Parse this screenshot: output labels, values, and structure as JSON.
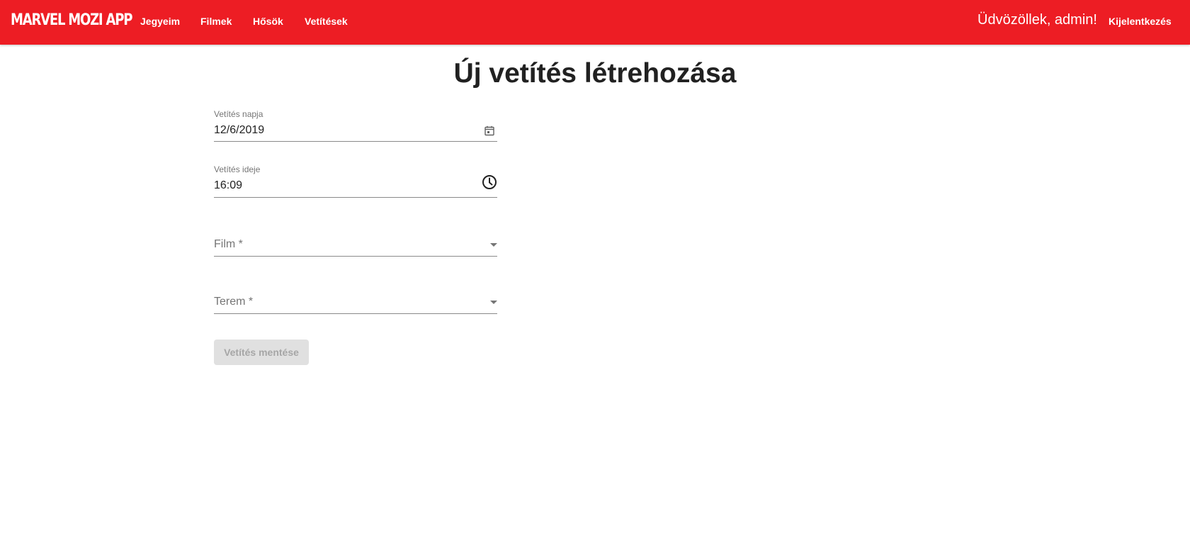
{
  "app": {
    "brand": "MARVEL MOZI APP",
    "brand_color": "#ED1D24"
  },
  "nav": {
    "items": [
      {
        "label": "Jegyeim"
      },
      {
        "label": "Filmek"
      },
      {
        "label": "Hősök"
      },
      {
        "label": "Vetítések"
      }
    ],
    "welcome": "Üdvözöllek, admin!",
    "logout": "Kijelentkezés"
  },
  "page": {
    "title": "Új vetítés létrehozása"
  },
  "form": {
    "date": {
      "label": "Vetítés napja",
      "value": "12/6/2019",
      "icon": "calendar-icon"
    },
    "time": {
      "label": "Vetítés ideje",
      "value": "16:09",
      "icon": "clock-icon"
    },
    "film": {
      "placeholder": "Film *"
    },
    "room": {
      "placeholder": "Terem *"
    },
    "save_label": "Vetítés mentése",
    "save_disabled": true
  }
}
